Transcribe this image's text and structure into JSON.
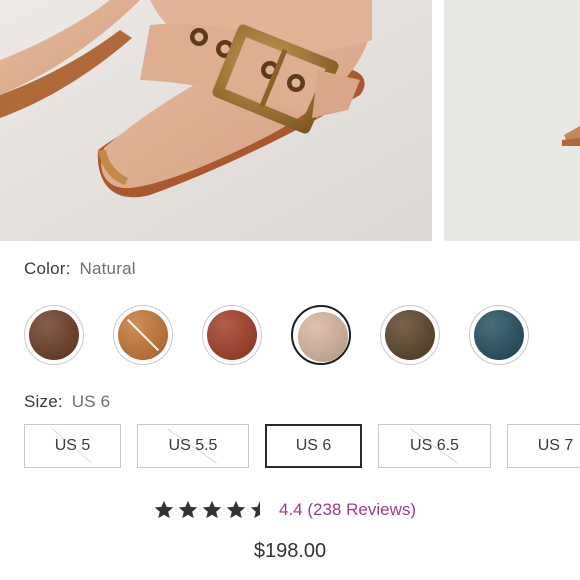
{
  "gallery": {
    "main_image_icon": "boot-closeup-photo",
    "next_image_icon": "boot-side-photo"
  },
  "color": {
    "label": "Color:",
    "selected": "Natural",
    "swatches": [
      {
        "color": "#6b3a22",
        "unavailable": false,
        "selected": false
      },
      {
        "color": "#c6742f",
        "unavailable": true,
        "selected": false
      },
      {
        "color": "#a03a22",
        "unavailable": false,
        "selected": false
      },
      {
        "color": "#d9b69e",
        "unavailable": false,
        "selected": true
      },
      {
        "color": "#5a4026",
        "unavailable": false,
        "selected": false
      },
      {
        "color": "#1f4d5e",
        "unavailable": false,
        "selected": false
      }
    ]
  },
  "size": {
    "label": "Size:",
    "selected": "US 6",
    "options": [
      {
        "label": "US 5",
        "unavailable": true,
        "selected": false
      },
      {
        "label": "US 5.5",
        "unavailable": true,
        "selected": false
      },
      {
        "label": "US 6",
        "unavailable": false,
        "selected": true
      },
      {
        "label": "US 6.5",
        "unavailable": true,
        "selected": false
      },
      {
        "label": "US 7",
        "unavailable": false,
        "selected": false
      }
    ]
  },
  "rating": {
    "stars": 4.4,
    "text": "4.4 (238 Reviews)",
    "accent": "#a23b86"
  },
  "price": "$198.00"
}
